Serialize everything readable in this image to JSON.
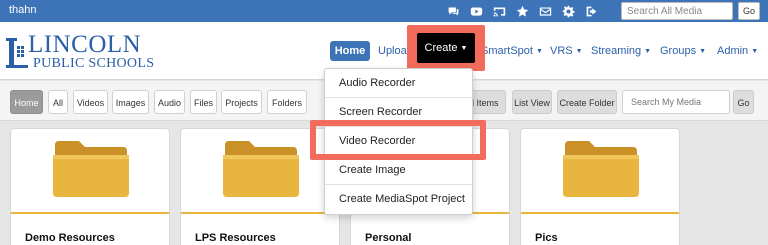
{
  "topbar": {
    "username": "thahn",
    "icons": [
      "chat-icon",
      "youtube-icon",
      "cast-icon",
      "star-icon",
      "mail-icon",
      "gear-icon",
      "sign-out-icon"
    ],
    "search_placeholder": "Search All Media",
    "go_label": "Go"
  },
  "logo": {
    "line1": "LINCOLN",
    "line2": "PUBLIC SCHOOLS"
  },
  "nav": {
    "home": "Home",
    "upload": "Upload",
    "create": "Create",
    "smartspot": "SmartSpot",
    "vrs": "VRS",
    "streaming": "Streaming",
    "groups": "Groups",
    "admin": "Admin"
  },
  "toolbar": {
    "home": "Home",
    "all": "All",
    "videos": "Videos",
    "images": "Images",
    "audio": "Audio",
    "files": "Files",
    "projects": "Projects",
    "folders": "Folders",
    "related_items": "ted Items",
    "list_view": "List View",
    "create_folder": "Create Folder",
    "search_placeholder": "Search My Media",
    "go_label": "Go"
  },
  "create_menu": {
    "items": [
      "Audio Recorder",
      "Screen Recorder",
      "Video Recorder",
      "Create Image",
      "Create MediaSpot Project"
    ]
  },
  "cards": [
    {
      "title": "Demo Resources"
    },
    {
      "title": "LPS Resources"
    },
    {
      "title": "Personal"
    },
    {
      "title": "Pics"
    }
  ],
  "colors": {
    "brand_blue": "#3d73b7",
    "highlight": "#f26b5b",
    "folder": "#e8b63e"
  }
}
